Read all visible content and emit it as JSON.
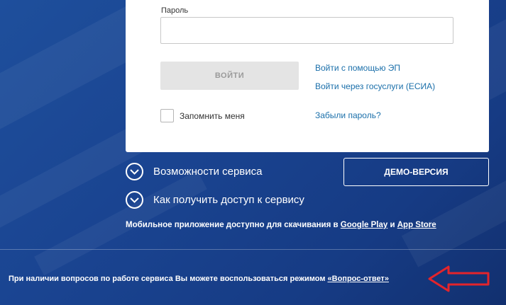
{
  "login_card": {
    "password_label": "Пароль",
    "password_value": "",
    "login_button": "ВОЙТИ",
    "link_ep": "Войти с помощью ЭП",
    "link_esia": "Войти через госуслуги (ЕСИА)",
    "remember_label": "Запомнить меня",
    "forgot_link": "Забыли пароль?"
  },
  "features": {
    "service_features": "Возможности сервиса",
    "access_howto": "Как получить доступ к сервису"
  },
  "demo_button": "ДЕМО-ВЕРСИЯ",
  "mobile": {
    "text": "Мобильное приложение доступно для скачивания в ",
    "google_play": "Google Play",
    "and": " и ",
    "app_store": "App Store"
  },
  "footer": {
    "text": "При наличии вопросов по работе сервиса Вы можете воспользоваться режимом ",
    "qa_link": "«Вопрос-ответ»"
  },
  "colors": {
    "background": "#1a4491",
    "link": "#1a6faa",
    "annotation_arrow": "#e3242b"
  },
  "icons": {
    "feature_toggle": "chevron-down-circle-icon",
    "annotation": "left-arrow-icon"
  }
}
